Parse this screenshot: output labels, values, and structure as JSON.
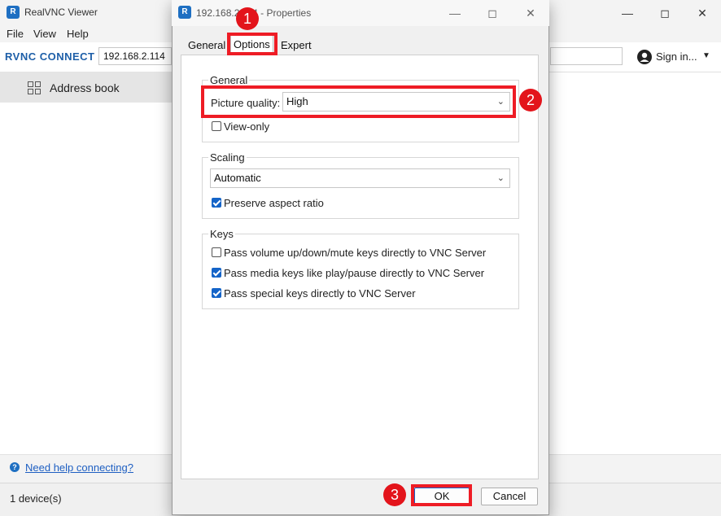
{
  "main_window": {
    "title": "RealVNC Viewer",
    "logo_letters": "R",
    "menu": [
      "File",
      "View",
      "Help"
    ],
    "brand": "RVNC CONNECT",
    "address_value": "192.168.2.114",
    "sign_in_label": "Sign in...",
    "sidebar_item": "Address book",
    "help_link": "Need help connecting?",
    "status": "1 device(s)"
  },
  "dialog": {
    "title": "192.168.2.114 - Properties",
    "tabs": [
      "General",
      "Options",
      "Expert"
    ],
    "active_tab": "Options",
    "general_group": {
      "title": "General",
      "picture_quality_label": "Picture quality:",
      "picture_quality_value": "High",
      "view_only_label": "View-only",
      "view_only_checked": false
    },
    "scaling_group": {
      "title": "Scaling",
      "scaling_value": "Automatic",
      "preserve_aspect_label": "Preserve aspect ratio",
      "preserve_aspect_checked": true
    },
    "keys_group": {
      "title": "Keys",
      "items": [
        {
          "label": "Pass volume up/down/mute keys directly to VNC Server",
          "checked": false
        },
        {
          "label": "Pass media keys like play/pause directly to VNC Server",
          "checked": true
        },
        {
          "label": "Pass special keys directly to VNC Server",
          "checked": true
        }
      ]
    },
    "ok_label": "OK",
    "cancel_label": "Cancel"
  },
  "annotations": {
    "badges": [
      "1",
      "2",
      "3"
    ],
    "color": "#e3141b"
  },
  "icons": {
    "minimize": "minimize-icon",
    "maximize": "maximize-icon",
    "close": "close-icon",
    "user": "user-icon",
    "address_book": "grid-icon",
    "help": "help-icon",
    "dropdown": "chevron-down-icon"
  },
  "colors": {
    "accent": "#1464c8",
    "link": "#1e5fc2",
    "highlight": "#ee1c25"
  }
}
